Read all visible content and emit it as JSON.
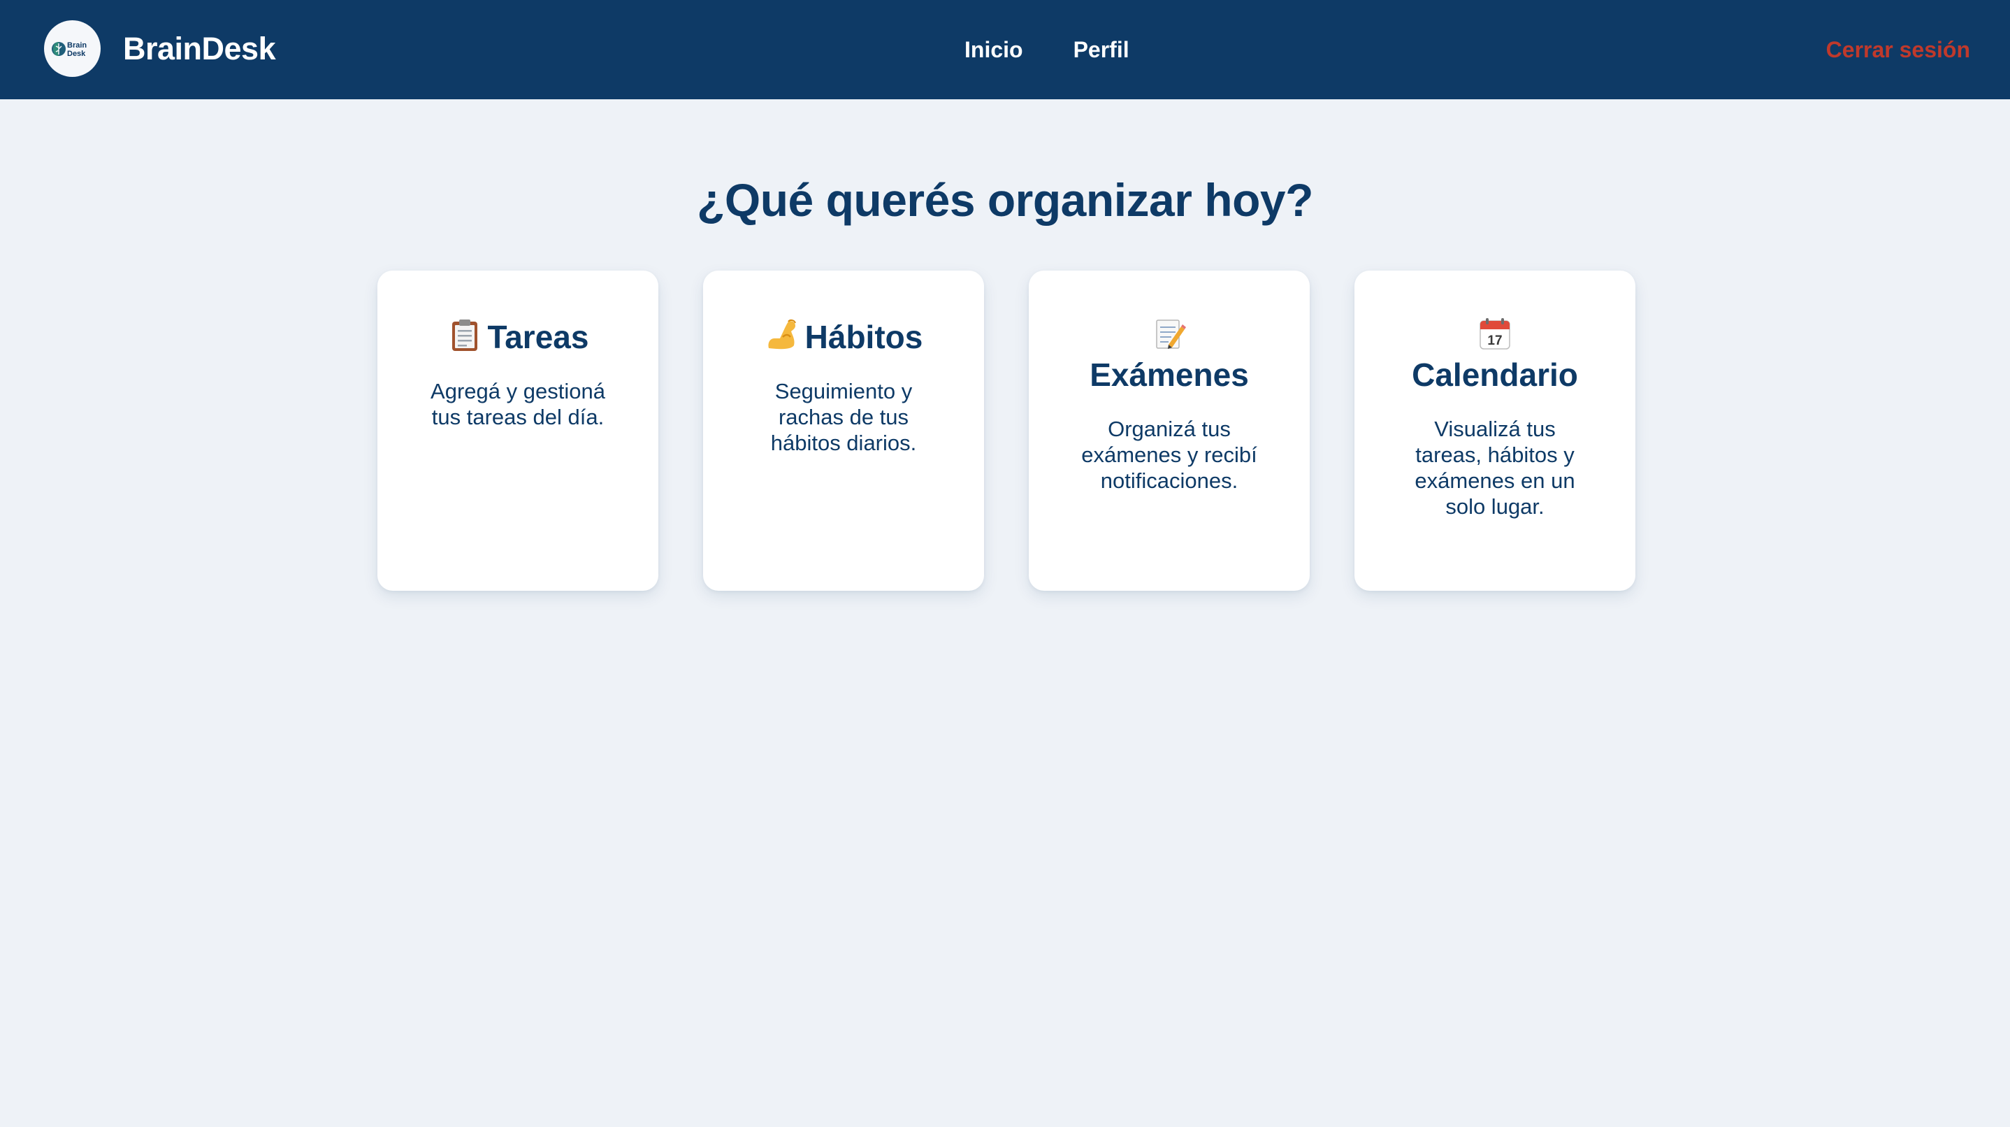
{
  "app": {
    "brand": "BrainDesk",
    "logo_text_line1": "Brain",
    "logo_text_line2": "Desk"
  },
  "nav": {
    "items": [
      {
        "label": "Inicio"
      },
      {
        "label": "Perfil"
      }
    ],
    "logout_label": "Cerrar sesión"
  },
  "main": {
    "heading": "¿Qué querés organizar hoy?",
    "cards": [
      {
        "icon": "clipboard-icon",
        "title": "Tareas",
        "description": "Agregá y gestioná tus tareas del día."
      },
      {
        "icon": "flexed-biceps-icon",
        "title": "Hábitos",
        "description": "Seguimiento y rachas de tus hábitos diarios."
      },
      {
        "icon": "memo-icon",
        "title": "Exámenes",
        "description": "Organizá tus exámenes y recibí notificaciones."
      },
      {
        "icon": "calendar-icon",
        "title": "Calendario",
        "description": "Visualizá tus tareas, hábitos y exámenes en un solo lugar.",
        "calendar_day": "17"
      }
    ]
  },
  "colors": {
    "navbar": "#0e3a66",
    "background": "#eef2f7",
    "heading": "#0e3a66",
    "logout": "#c0392b",
    "card": "#ffffff"
  }
}
